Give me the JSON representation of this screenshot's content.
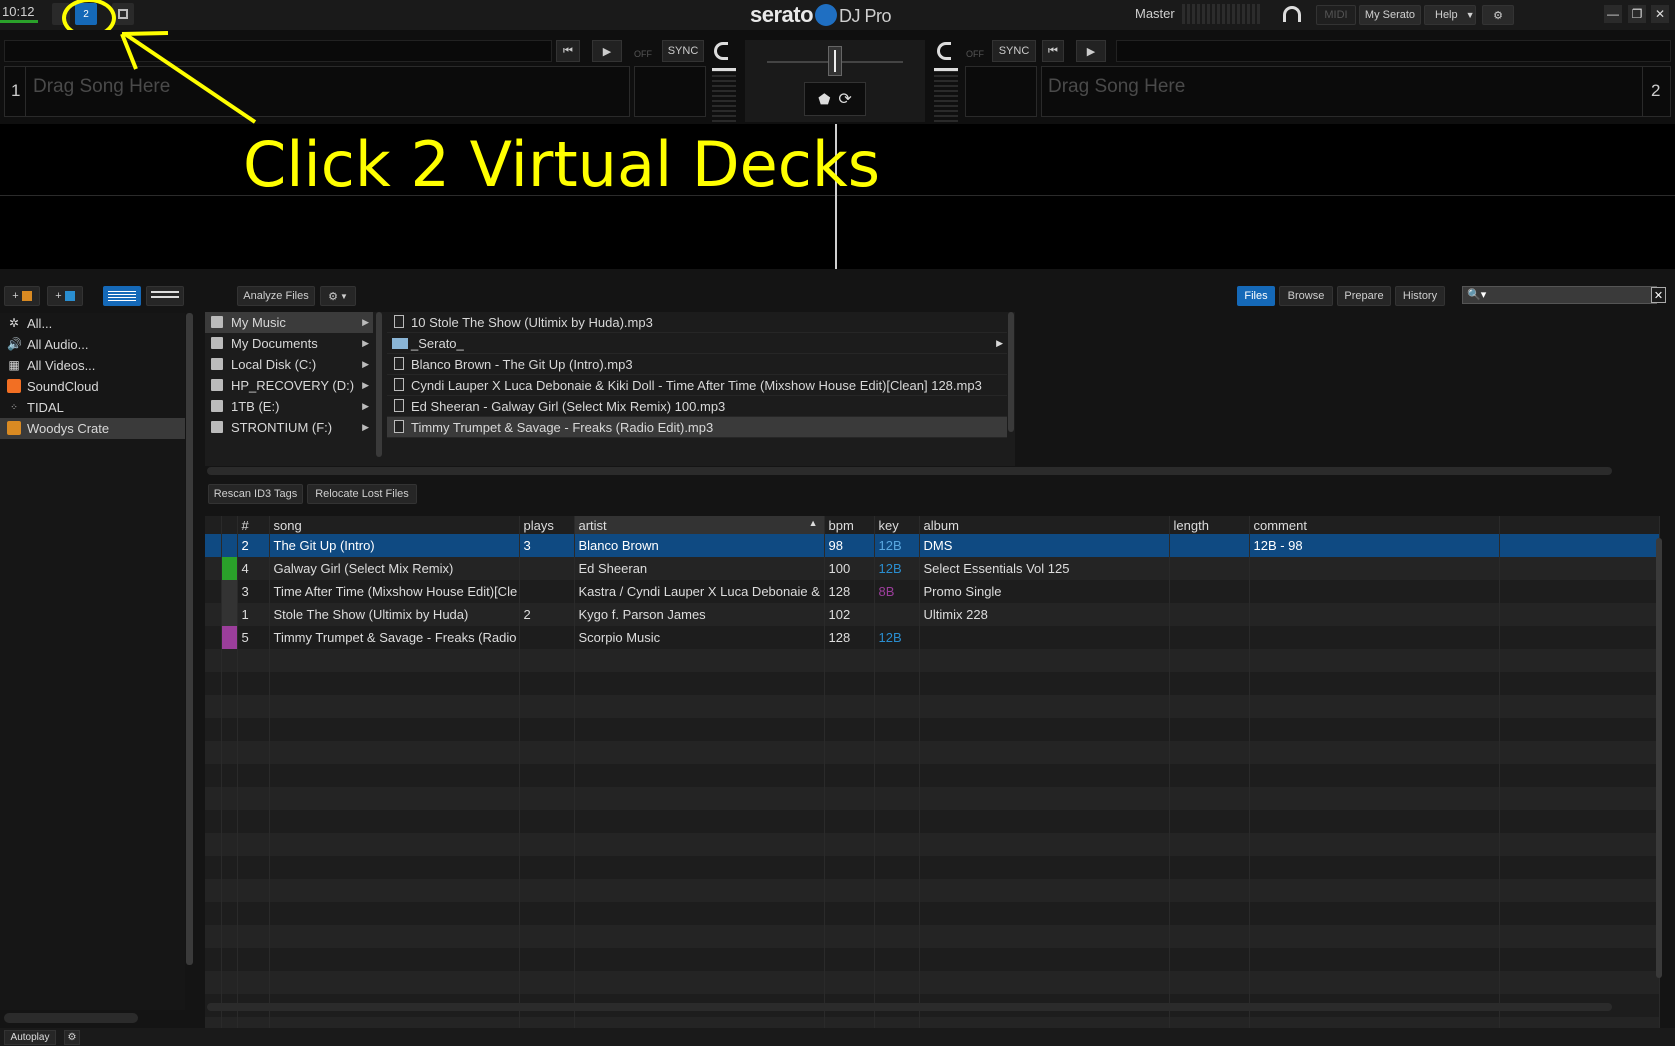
{
  "topbar": {
    "clock": "10:12",
    "deck_selector_label": "2",
    "logo_text": "serato",
    "logo_suffix": "DJ Pro",
    "master_label": "Master",
    "midi_label": "MIDI",
    "my_serato_label": "My Serato",
    "help_label": "Help",
    "accent_color": "#1569b8"
  },
  "deck1": {
    "number": "1",
    "placeholder": "Drag Song Here",
    "off_label": "OFF",
    "sync_label": "SYNC"
  },
  "deck2": {
    "number": "2",
    "placeholder": "Drag Song Here",
    "off_label": "OFF",
    "sync_label": "SYNC"
  },
  "annotation": {
    "text": "Click 2 Virtual Decks",
    "color": "#ffff00"
  },
  "library_toolbar": {
    "analyze_label": "Analyze Files",
    "tabs": [
      "Files",
      "Browse",
      "Prepare",
      "History"
    ],
    "active_tab": "Files"
  },
  "crates": [
    {
      "label": "All...",
      "icon": "asterisk-icon"
    },
    {
      "label": "All Audio...",
      "icon": "speaker-icon"
    },
    {
      "label": "All Videos...",
      "icon": "film-icon"
    },
    {
      "label": "SoundCloud",
      "icon": "soundcloud-icon"
    },
    {
      "label": "TIDAL",
      "icon": "tidal-icon"
    },
    {
      "label": "Woodys Crate",
      "icon": "crate-icon",
      "selected": true
    }
  ],
  "drives": [
    {
      "label": "My Music",
      "selected": true
    },
    {
      "label": "My Documents"
    },
    {
      "label": "Local Disk (C:)"
    },
    {
      "label": "HP_RECOVERY (D:)"
    },
    {
      "label": "1TB (E:)"
    },
    {
      "label": "STRONTIUM (F:)"
    }
  ],
  "files": [
    {
      "label": "10 Stole The Show (Ultimix by Huda).mp3",
      "type": "file"
    },
    {
      "label": "_Serato_",
      "type": "folder"
    },
    {
      "label": "Blanco Brown - The Git Up (Intro).mp3",
      "type": "file"
    },
    {
      "label": "Cyndi Lauper X Luca Debonaie & Kiki Doll - Time After Time (Mixshow House Edit)[Clean] 128.mp3",
      "type": "file"
    },
    {
      "label": "Ed Sheeran - Galway Girl (Select Mix Remix) 100.mp3",
      "type": "file"
    },
    {
      "label": "Timmy Trumpet & Savage - Freaks (Radio Edit).mp3",
      "type": "file",
      "selected": true
    }
  ],
  "file_actions": {
    "rescan_label": "Rescan ID3 Tags",
    "relocate_label": "Relocate Lost Files"
  },
  "columns": [
    "#",
    "song",
    "plays",
    "artist",
    "bpm",
    "key",
    "album",
    "length",
    "comment"
  ],
  "tracks": [
    {
      "num": "2",
      "song": "The Git Up (Intro)",
      "plays": "3",
      "artist": "Blanco Brown",
      "bpm": "98",
      "key": "12B",
      "album": "DMS",
      "length": "",
      "comment": "12B - 98",
      "color": "#0f4a82",
      "selected": true
    },
    {
      "num": "4",
      "song": "Galway Girl (Select Mix Remix)",
      "plays": "",
      "artist": "Ed Sheeran",
      "bpm": "100",
      "key": "12B",
      "album": "Select Essentials Vol 125",
      "length": "",
      "comment": "",
      "color": "#2aa12a"
    },
    {
      "num": "3",
      "song": "Time After Time (Mixshow House Edit)[Cle",
      "plays": "",
      "artist": "Kastra / Cyndi Lauper X Luca Debonaie &",
      "bpm": "128",
      "key": "8B",
      "album": "Promo Single",
      "length": "",
      "comment": "",
      "color": "#333333"
    },
    {
      "num": "1",
      "song": "Stole The Show (Ultimix by Huda)",
      "plays": "2",
      "artist": "Kygo f. Parson James",
      "bpm": "102",
      "key": "",
      "album": "Ultimix 228",
      "length": "",
      "comment": "",
      "color": "#333333"
    },
    {
      "num": "5",
      "song": "Timmy Trumpet & Savage - Freaks (Radio",
      "plays": "",
      "artist": "Scorpio Music",
      "bpm": "128",
      "key": "12B",
      "album": "",
      "length": "",
      "comment": "",
      "color": "#9b3e9b"
    }
  ],
  "bottombar": {
    "autoplay_label": "Autoplay"
  }
}
